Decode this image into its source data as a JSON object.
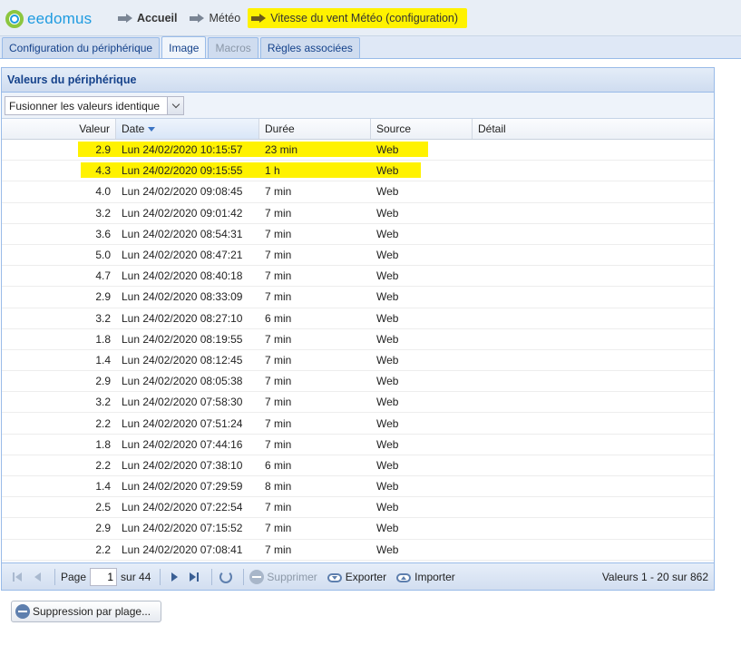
{
  "header": {
    "logo_text": "eedomus",
    "breadcrumb": [
      {
        "label": "Accueil"
      },
      {
        "label": "Météo"
      },
      {
        "label": "Vitesse du vent Météo (configuration)"
      }
    ],
    "highlight_color": "#fff200"
  },
  "tabs": [
    {
      "label": "Configuration du périphérique",
      "state": "normal"
    },
    {
      "label": "Image",
      "state": "active"
    },
    {
      "label": "Macros",
      "state": "disabled"
    },
    {
      "label": "Règles associées",
      "state": "normal"
    }
  ],
  "panel": {
    "title": "Valeurs du périphérique",
    "merge_select": {
      "value": "Fusionner les valeurs identique"
    }
  },
  "grid": {
    "columns": {
      "value": "Valeur",
      "date": "Date",
      "duration": "Durée",
      "source": "Source",
      "detail": "Détail"
    },
    "rows": [
      {
        "value": "2.9",
        "date": "Lun 24/02/2020 10:15:57",
        "duration": "23 min",
        "source": "Web",
        "detail": ""
      },
      {
        "value": "4.3",
        "date": "Lun 24/02/2020 09:15:55",
        "duration": "1 h",
        "source": "Web",
        "detail": ""
      },
      {
        "value": "4.0",
        "date": "Lun 24/02/2020 09:08:45",
        "duration": "7 min",
        "source": "Web",
        "detail": ""
      },
      {
        "value": "3.2",
        "date": "Lun 24/02/2020 09:01:42",
        "duration": "7 min",
        "source": "Web",
        "detail": ""
      },
      {
        "value": "3.6",
        "date": "Lun 24/02/2020 08:54:31",
        "duration": "7 min",
        "source": "Web",
        "detail": ""
      },
      {
        "value": "5.0",
        "date": "Lun 24/02/2020 08:47:21",
        "duration": "7 min",
        "source": "Web",
        "detail": ""
      },
      {
        "value": "4.7",
        "date": "Lun 24/02/2020 08:40:18",
        "duration": "7 min",
        "source": "Web",
        "detail": ""
      },
      {
        "value": "2.9",
        "date": "Lun 24/02/2020 08:33:09",
        "duration": "7 min",
        "source": "Web",
        "detail": ""
      },
      {
        "value": "3.2",
        "date": "Lun 24/02/2020 08:27:10",
        "duration": "6 min",
        "source": "Web",
        "detail": ""
      },
      {
        "value": "1.8",
        "date": "Lun 24/02/2020 08:19:55",
        "duration": "7 min",
        "source": "Web",
        "detail": ""
      },
      {
        "value": "1.4",
        "date": "Lun 24/02/2020 08:12:45",
        "duration": "7 min",
        "source": "Web",
        "detail": ""
      },
      {
        "value": "2.9",
        "date": "Lun 24/02/2020 08:05:38",
        "duration": "7 min",
        "source": "Web",
        "detail": ""
      },
      {
        "value": "3.2",
        "date": "Lun 24/02/2020 07:58:30",
        "duration": "7 min",
        "source": "Web",
        "detail": ""
      },
      {
        "value": "2.2",
        "date": "Lun 24/02/2020 07:51:24",
        "duration": "7 min",
        "source": "Web",
        "detail": ""
      },
      {
        "value": "1.8",
        "date": "Lun 24/02/2020 07:44:16",
        "duration": "7 min",
        "source": "Web",
        "detail": ""
      },
      {
        "value": "2.2",
        "date": "Lun 24/02/2020 07:38:10",
        "duration": "6 min",
        "source": "Web",
        "detail": ""
      },
      {
        "value": "1.4",
        "date": "Lun 24/02/2020 07:29:59",
        "duration": "8 min",
        "source": "Web",
        "detail": ""
      },
      {
        "value": "2.5",
        "date": "Lun 24/02/2020 07:22:54",
        "duration": "7 min",
        "source": "Web",
        "detail": ""
      },
      {
        "value": "2.9",
        "date": "Lun 24/02/2020 07:15:52",
        "duration": "7 min",
        "source": "Web",
        "detail": ""
      },
      {
        "value": "2.2",
        "date": "Lun 24/02/2020 07:08:41",
        "duration": "7 min",
        "source": "Web",
        "detail": ""
      }
    ]
  },
  "pager": {
    "page_label": "Page",
    "page_value": "1",
    "of_label": "sur 44",
    "delete_label": "Supprimer",
    "export_label": "Exporter",
    "import_label": "Importer",
    "info": "Valeurs 1 - 20 sur 862"
  },
  "bottom": {
    "range_delete_label": "Suppression par plage..."
  }
}
